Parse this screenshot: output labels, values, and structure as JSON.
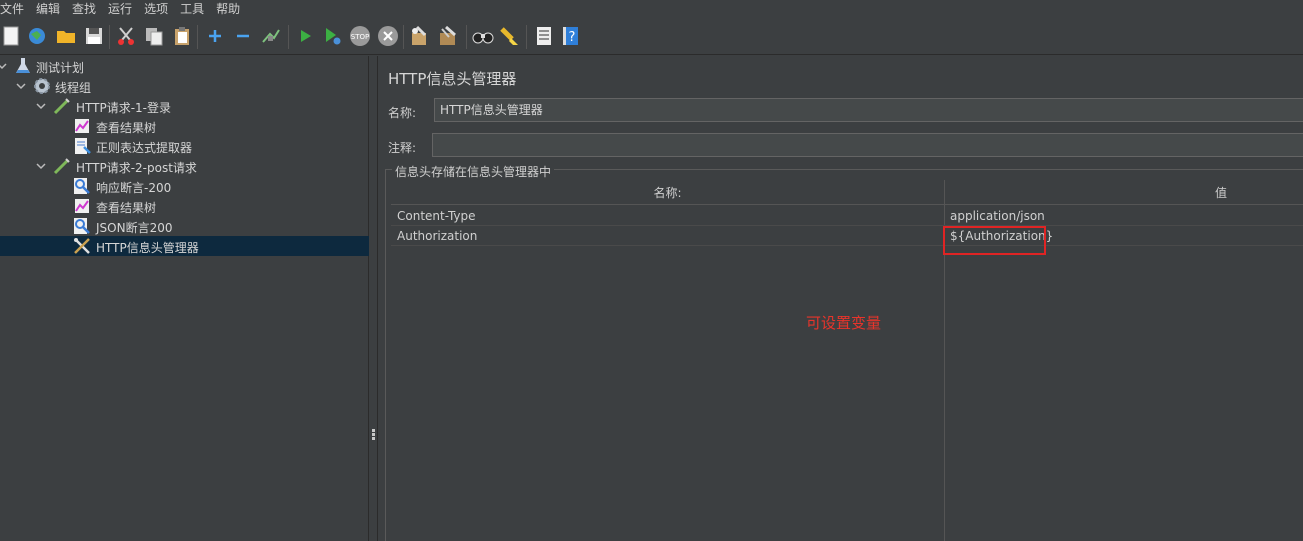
{
  "menu": [
    "文件",
    "编辑",
    "查找",
    "运行",
    "选项",
    "工具",
    "帮助"
  ],
  "toolbar": {
    "icons": [
      "new-icon",
      "templates-icon",
      "open-icon",
      "save-icon",
      "cut-icon",
      "copy-icon",
      "paste-icon",
      "expand-icon",
      "collapse-icon",
      "toggle-icon",
      "start-icon",
      "start-no-pause-icon",
      "stop-icon",
      "shutdown-icon",
      "clear-icon",
      "clear-all-icon",
      "search-icon",
      "reset-search-icon",
      "function-helper-icon",
      "help-icon"
    ]
  },
  "tree": {
    "items": [
      {
        "label": "测试计划",
        "icon": "test-plan-icon"
      },
      {
        "label": "线程组",
        "icon": "thread-group-icon"
      },
      {
        "label": "HTTP请求-1-登录",
        "icon": "http-sampler-icon"
      },
      {
        "label": "查看结果树",
        "icon": "listener-icon"
      },
      {
        "label": "正则表达式提取器",
        "icon": "extractor-icon"
      },
      {
        "label": "HTTP请求-2-post请求",
        "icon": "http-sampler-icon"
      },
      {
        "label": "响应断言-200",
        "icon": "assertion-icon"
      },
      {
        "label": "查看结果树",
        "icon": "listener-icon"
      },
      {
        "label": "JSON断言200",
        "icon": "assertion-icon"
      },
      {
        "label": "HTTP信息头管理器",
        "icon": "header-manager-icon"
      }
    ],
    "selected_index": 9
  },
  "panel": {
    "title": "HTTP信息头管理器",
    "name_label": "名称:",
    "name_value": "HTTP信息头管理器",
    "comment_label": "注释:",
    "comment_value": "",
    "group_title": "信息头存储在信息头管理器中",
    "table": {
      "headers": [
        "名称:",
        "值"
      ],
      "rows": [
        {
          "name": "Content-Type",
          "value": "application/json"
        },
        {
          "name": "Authorization",
          "value": "${Authorization}"
        }
      ]
    },
    "annotation": "可设置变量"
  },
  "colors": {
    "background": "#3c3f41",
    "selection": "#0d293e",
    "annotation_red": "#e8342b",
    "highlight_border": "#e02424"
  }
}
